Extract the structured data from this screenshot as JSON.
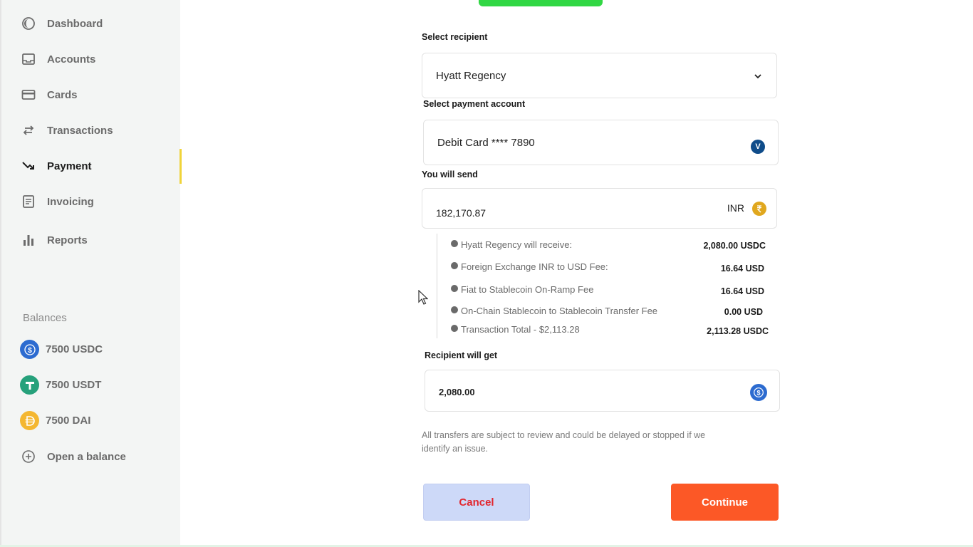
{
  "sidebar": {
    "items": [
      {
        "label": "Dashboard",
        "icon": "dashboard-icon"
      },
      {
        "label": "Accounts",
        "icon": "inbox-icon"
      },
      {
        "label": "Cards",
        "icon": "card-icon"
      },
      {
        "label": "Transactions",
        "icon": "swap-arrows-icon"
      },
      {
        "label": "Payment",
        "icon": "payment-arrow-icon",
        "active": true
      },
      {
        "label": "Invoicing",
        "icon": "document-icon"
      },
      {
        "label": "Reports",
        "icon": "bar-chart-icon"
      }
    ],
    "balances_title": "Balances",
    "balances": [
      {
        "label": "7500 USDC",
        "icon": "usdc-coin-icon",
        "color": "#2c6bd0"
      },
      {
        "label": "7500 USDT",
        "icon": "usdt-coin-icon",
        "color": "#26a17b"
      },
      {
        "label": "7500 DAI",
        "icon": "dai-coin-icon",
        "color": "#f4b731"
      }
    ],
    "open_balance": {
      "label": "Open a balance",
      "icon": "plus-circle-icon"
    }
  },
  "form": {
    "recipient": {
      "label": "Select  recipient",
      "value": "Hyatt Regency"
    },
    "payment_account": {
      "label": "Select payment account",
      "value": "Debit Card **** 7890",
      "badge": "V"
    },
    "send": {
      "label": "You will send",
      "amount": "182,170.87",
      "currency": "INR"
    },
    "breakdown": [
      {
        "name": "Hyatt Regency will receive:",
        "value": "2,080.00 USDC"
      },
      {
        "name": "Foreign Exchange INR to USD Fee:",
        "value": "16.64 USD"
      },
      {
        "name": "Fiat to Stablecoin On-Ramp Fee",
        "value": "16.64 USD"
      },
      {
        "name": "On-Chain Stablecoin to Stablecoin Transfer Fee",
        "value": "0.00 USD"
      },
      {
        "name": "Transaction Total - $2,113.28",
        "value": "2,113.28 USDC"
      }
    ],
    "receive": {
      "label": "Recipient will get",
      "amount": "2,080.00"
    },
    "disclaimer": "All transfers are subject to review and could be delayed or stopped if we identify an issue.",
    "cancel_label": "Cancel",
    "continue_label": "Continue"
  },
  "colors": {
    "accent": "#fc5826",
    "active_bar": "#f0d43a",
    "success": "#31d744"
  }
}
